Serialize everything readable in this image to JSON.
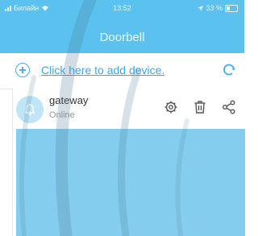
{
  "status_bar": {
    "carrier": "Билайн",
    "time": "13:52",
    "battery": "33 %"
  },
  "header": {
    "title": "Doorbell"
  },
  "add_device": {
    "link_text": "Click here to add device."
  },
  "devices": [
    {
      "name": "gateway",
      "status": "Online"
    }
  ],
  "colors": {
    "accent": "#5bc2ef",
    "link": "#3da6e3",
    "preview": "#85cdee"
  },
  "icons": [
    "add-circle-icon",
    "refresh-icon",
    "bell-icon",
    "settings-icon",
    "delete-icon",
    "share-icon"
  ]
}
